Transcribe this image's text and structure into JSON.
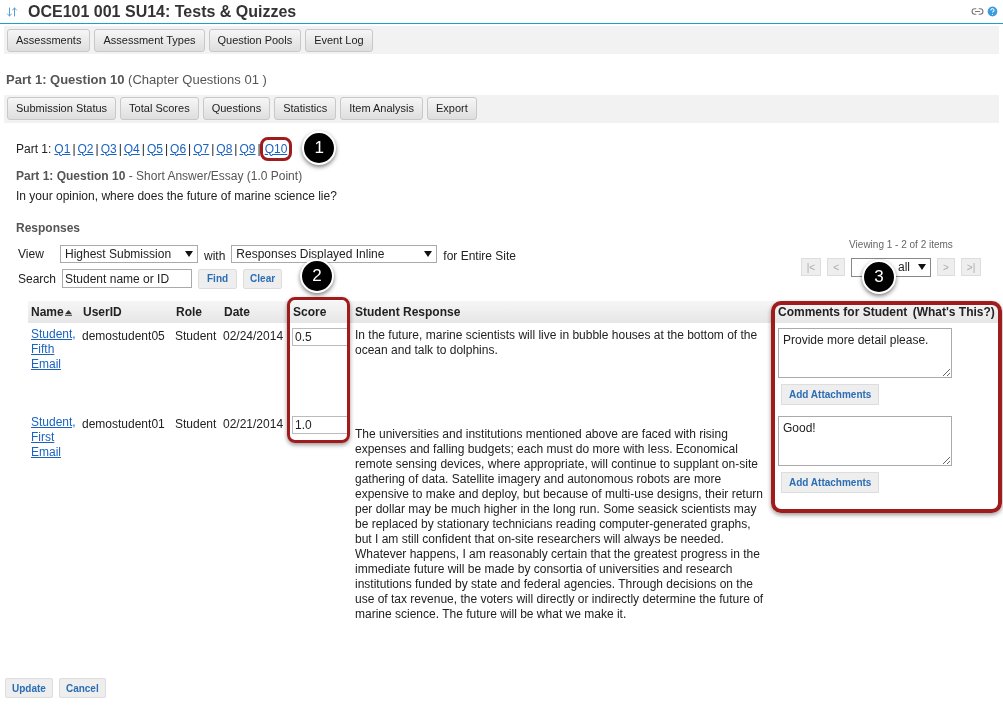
{
  "header": {
    "title": "OCE101 001 SU14: Tests & Quizzes"
  },
  "tool_nav": [
    "Assessments",
    "Assessment Types",
    "Question Pools",
    "Event Log"
  ],
  "page_heading": {
    "title": "Part 1: Question 10",
    "subtitle": "(Chapter Questions 01 )"
  },
  "sub_nav": [
    "Submission Status",
    "Total Scores",
    "Questions",
    "Statistics",
    "Item Analysis",
    "Export"
  ],
  "question_nav": {
    "label": "Part 1:",
    "separator": "|",
    "links": [
      "Q1",
      "Q2",
      "Q3",
      "Q4",
      "Q5",
      "Q6",
      "Q7",
      "Q8",
      "Q9",
      "Q10"
    ]
  },
  "question": {
    "title": "Part 1: Question 10",
    "type": "- Short Answer/Essay (1.0 Point)",
    "text": "In your opinion, where does the future of marine science lie?"
  },
  "responses": {
    "heading": "Responses",
    "view_label": "View",
    "view_value": "Highest Submission",
    "with_label": "with",
    "display_value": "Responses Displayed Inline",
    "scope": "for Entire Site",
    "search_label": "Search",
    "search_value": "Student name or ID",
    "find": "Find",
    "clear": "Clear"
  },
  "pager": {
    "summary": "Viewing 1 - 2 of 2 items",
    "page_size": "all",
    "buttons": [
      "|<",
      "<",
      ">",
      ">|"
    ]
  },
  "table": {
    "columns": [
      "Name",
      "UserID",
      "Role",
      "Date",
      "Score",
      "Student Response"
    ],
    "comments_column": {
      "label": "Comments for Student",
      "link": "(What's This?)"
    },
    "rows": [
      {
        "name": "Student, Fifth",
        "email": "Email",
        "user_id": "demostudent05",
        "role": "Student",
        "date": "02/24/2014",
        "score": "0.5",
        "response": "In the future, marine scientists will live in bubble houses at the bottom of the ocean and talk to dolphins.",
        "comment": "Provide more detail please.",
        "attach": "Add Attachments"
      },
      {
        "name": "Student, First",
        "email": "Email",
        "user_id": "demostudent01",
        "role": "Student",
        "date": "02/21/2014",
        "score": "1.0",
        "response": "The universities and institutions mentioned above are faced with rising expenses and falling budgets; each must do more with less. Economical remote sensing devices, where appropriate, will continue to supplant on-site gathering of data. Satellite imagery and autonomous robots are more expensive to make and deploy, but because of multi-use designs, their return per dollar may be much higher in the long run. Some seasick scientists may be replaced by stationary technicians reading computer-generated graphs, but I am still confident that on-site researchers will always be needed. Whatever happens, I am reasonably certain that the greatest progress in the immediate future will be made by consortia of universities and research institutions funded by state and federal agencies. Through decisions on the use of tax revenue, the voters will directly or indirectly determine the future of marine science. The future will be what we make it.",
        "comment": "Good!",
        "attach": "Add Attachments"
      }
    ]
  },
  "footer_buttons": [
    "Update",
    "Cancel"
  ],
  "callouts": [
    "1",
    "2",
    "3"
  ]
}
